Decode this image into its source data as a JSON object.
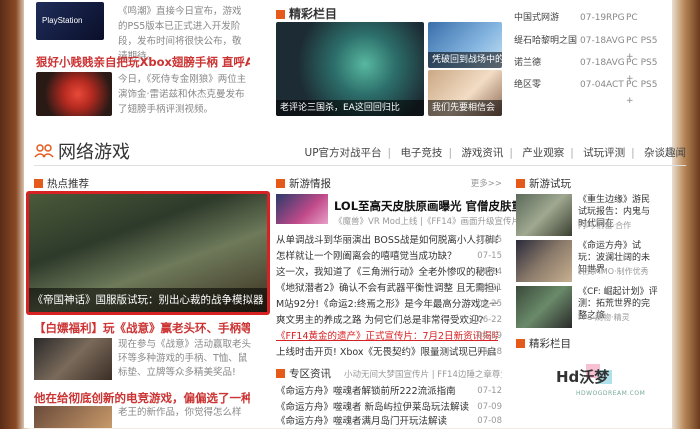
{
  "top_news": [
    {
      "title": "",
      "text": "《鸣潮》直接今日宣布，游戏的PS5版本已正式进入开发阶段，发布时间将很快公布，敬请期待。"
    },
    {
      "title": "狠好小贱贱亲自把玩Xbox翅膀手柄 直呼Amazing!",
      "text": "今日，《死侍专金刚狼》两位主演饰金·雷诺兹和休杰克曼发布了翅膀手柄评测视频。"
    }
  ],
  "jingcai": {
    "header": "精彩栏目",
    "captions": [
      "老评论三国杀，EA这回回归比",
      "凭破回到战场中的",
      "我们先要相信会"
    ]
  },
  "game_table": [
    {
      "name": "中国式网游",
      "date": "07-19",
      "type": "RPG",
      "platform": "PC"
    },
    {
      "name": "缇石哈黎明之国",
      "date": "07-18",
      "type": "AVG",
      "platform": "PC PS5 +"
    },
    {
      "name": "诺兰德",
      "date": "07-18",
      "type": "AVG",
      "platform": "PC PS5 +"
    },
    {
      "name": "绝区零",
      "date": "07-04",
      "type": "ACT",
      "platform": "PC PS5 +"
    }
  ],
  "section": {
    "title": "网络游戏",
    "nav": [
      "UP官方对战平台",
      "电子竞技",
      "游戏资讯",
      "产业观察",
      "试玩评测",
      "杂谈趣闻"
    ]
  },
  "hot": {
    "header": "热点推荐",
    "caption": "《帝国神话》国服版试玩：别出心裁的战争模拟器"
  },
  "left_news": [
    {
      "title": "【白嫖福利】玩《战意》赢老头环、手柄等好礼",
      "text": "现在参与《战意》活动赢取老头环等多种游戏的手柄、T恤、鼠标垫、立牌等众多精美奖品!"
    },
    {
      "title": "他在给彻底创新的电竞游戏，偏偏选了一种最痛的玩法",
      "text": "老王的新作品，你觉得怎么样"
    }
  ],
  "xinzhi": {
    "header": "新游情报",
    "more": "更多>>",
    "feature_title": "LOL至高天皮肤原画曝光 官僧皮肤重做",
    "feature_sub": "《魔兽》VR Mod上线 |《FF14》画面升级宣传片",
    "list": [
      {
        "title": "从单调战斗到华丽演出 BOSS战是如何脱离小人打脚的",
        "date": "07-15"
      },
      {
        "title": "怎样就让一个刚阖离会的嘻嘻觉当成功缺？",
        "date": "07-15"
      },
      {
        "title": "这一次，我知道了《三角洲行动》全老外惨叹的秘密!",
        "date": "06-24"
      },
      {
        "title": "《地狱潜者2》确认不会有武器平衡性调整 且无需担心",
        "date": "06-21"
      },
      {
        "title": "M站92分!《命运2:终焉之形》是今年最高分游戏之一",
        "date": "06-25"
      },
      {
        "title": "爽文男主的养成之路 为何它们总是非常得受欢迎?",
        "date": "06-22"
      },
      {
        "title": "《FF14黄金的遗产》正式宣传片：7月2日新资讯揭晓!",
        "date": "06-19",
        "highlight": true
      },
      {
        "title": "上线时击开页! Xbox《无畏契约》限量测试现已开启",
        "date": "06-18"
      }
    ]
  },
  "zhuanqu": {
    "header": "专区资讯",
    "sub": "小动无间大梦国宣传片 | FF14边陲之章尊贵3.1",
    "list": [
      {
        "title": "《命运方舟》噬魂者解锁前所222流派指南",
        "date": "07-12"
      },
      {
        "title": "《命运方舟》噬魂者 新岛屿拉伊莱岛玩法解读",
        "date": "07-09"
      },
      {
        "title": "《命运方舟》噬魂者满月岛门开玩法解读",
        "date": "07-08"
      }
    ]
  },
  "new_trial": {
    "header": "新游试玩",
    "items": [
      {
        "title": "《重生边缘》游民试玩报告：内鬼与时代同在",
        "sub": "内鸣·射击·合作"
      },
      {
        "title": "《命运方舟》试玩：波澜壮阔的未知世界",
        "sub": "韩式MMO·制作优秀"
      },
      {
        "title": "《CF: 崛起计划》评测：拓荒世界的完整之旅",
        "sub": "FPS·刷物·精灵"
      }
    ],
    "jingcai_header": "精彩栏目"
  },
  "logo": {
    "text": "Hd沃梦",
    "sub": "HDWOGDREAM.COM"
  },
  "colors": {
    "accent": "#e55a1b",
    "highlight": "#d62222"
  }
}
